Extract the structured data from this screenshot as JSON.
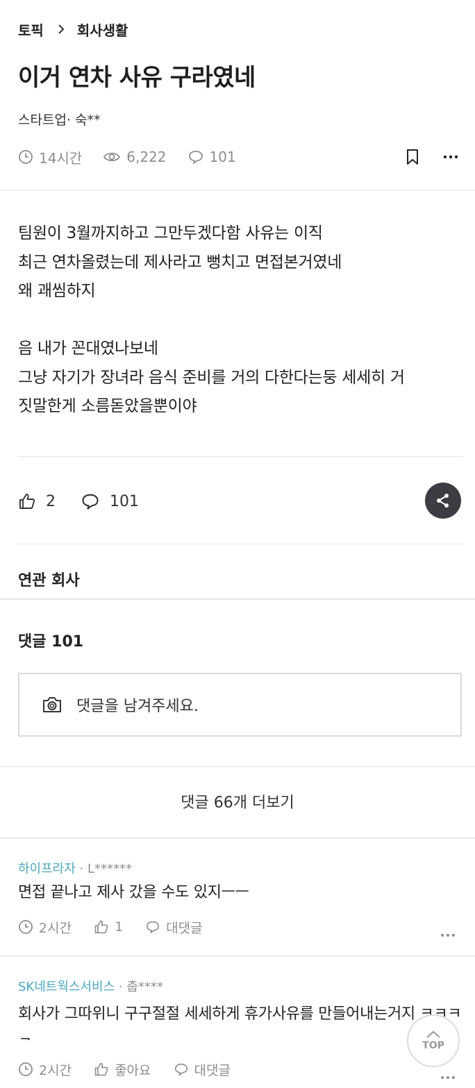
{
  "breadcrumb": {
    "root": "토픽",
    "current": "회사생활"
  },
  "post": {
    "title": "이거 연차 사유 구라였네",
    "author": "스타트업· 숙**",
    "time": "14시간",
    "views": "6,222",
    "comment_count": "101",
    "body_lines": [
      "팀원이 3월까지하고 그만두겠다함 사유는 이직",
      "최근 연차올렸는데 제사라고 뻥치고 면접본거였네",
      "왜 괘씸하지",
      "",
      "음 내가 꼰대였나보네",
      "그냥 자기가 장녀라 음식 준비를 거의 다한다는둥 세세히 거",
      "짓말한게 소름돋았을뿐이야"
    ],
    "likes": "2",
    "comments": "101"
  },
  "related": {
    "title": "연관 회사"
  },
  "comments_section": {
    "title": "댓글 101",
    "placeholder": "댓글을 남겨주세요.",
    "more_label": "댓글 66개 더보기"
  },
  "comments": [
    {
      "company": "하이프라자",
      "masked_name": " · L******",
      "text": "면접 끝나고 제사 갔을 수도 있지ㅡㅡ",
      "time": "2시간",
      "likes": "1",
      "reply_label": "대댓글"
    },
    {
      "company": "SK네트웍스서비스",
      "masked_name": " · 춥****",
      "text": "회사가 그따위니 구구절절 세세하게 휴가사유를 만들어내는거지 ㅋㅋㅋㅋ",
      "time": "2시간",
      "likes": "좋아요",
      "reply_label": "대댓글"
    }
  ],
  "top_button": {
    "label": "TOP"
  },
  "icons": {
    "breadcrumb_separator": "chevron-right-icon",
    "time": "clock-icon",
    "views": "eye-icon",
    "comments": "speech-bubble-icon",
    "bookmark": "bookmark-icon",
    "more": "more-dots-icon",
    "like": "thumbs-up-icon",
    "share": "share-icon",
    "camera": "camera-icon",
    "top": "chevron-up-icon"
  },
  "colors": {
    "company_link": "#4aa8bf",
    "meta_gray": "#8e8e8e",
    "share_button": "#3c3d43"
  }
}
